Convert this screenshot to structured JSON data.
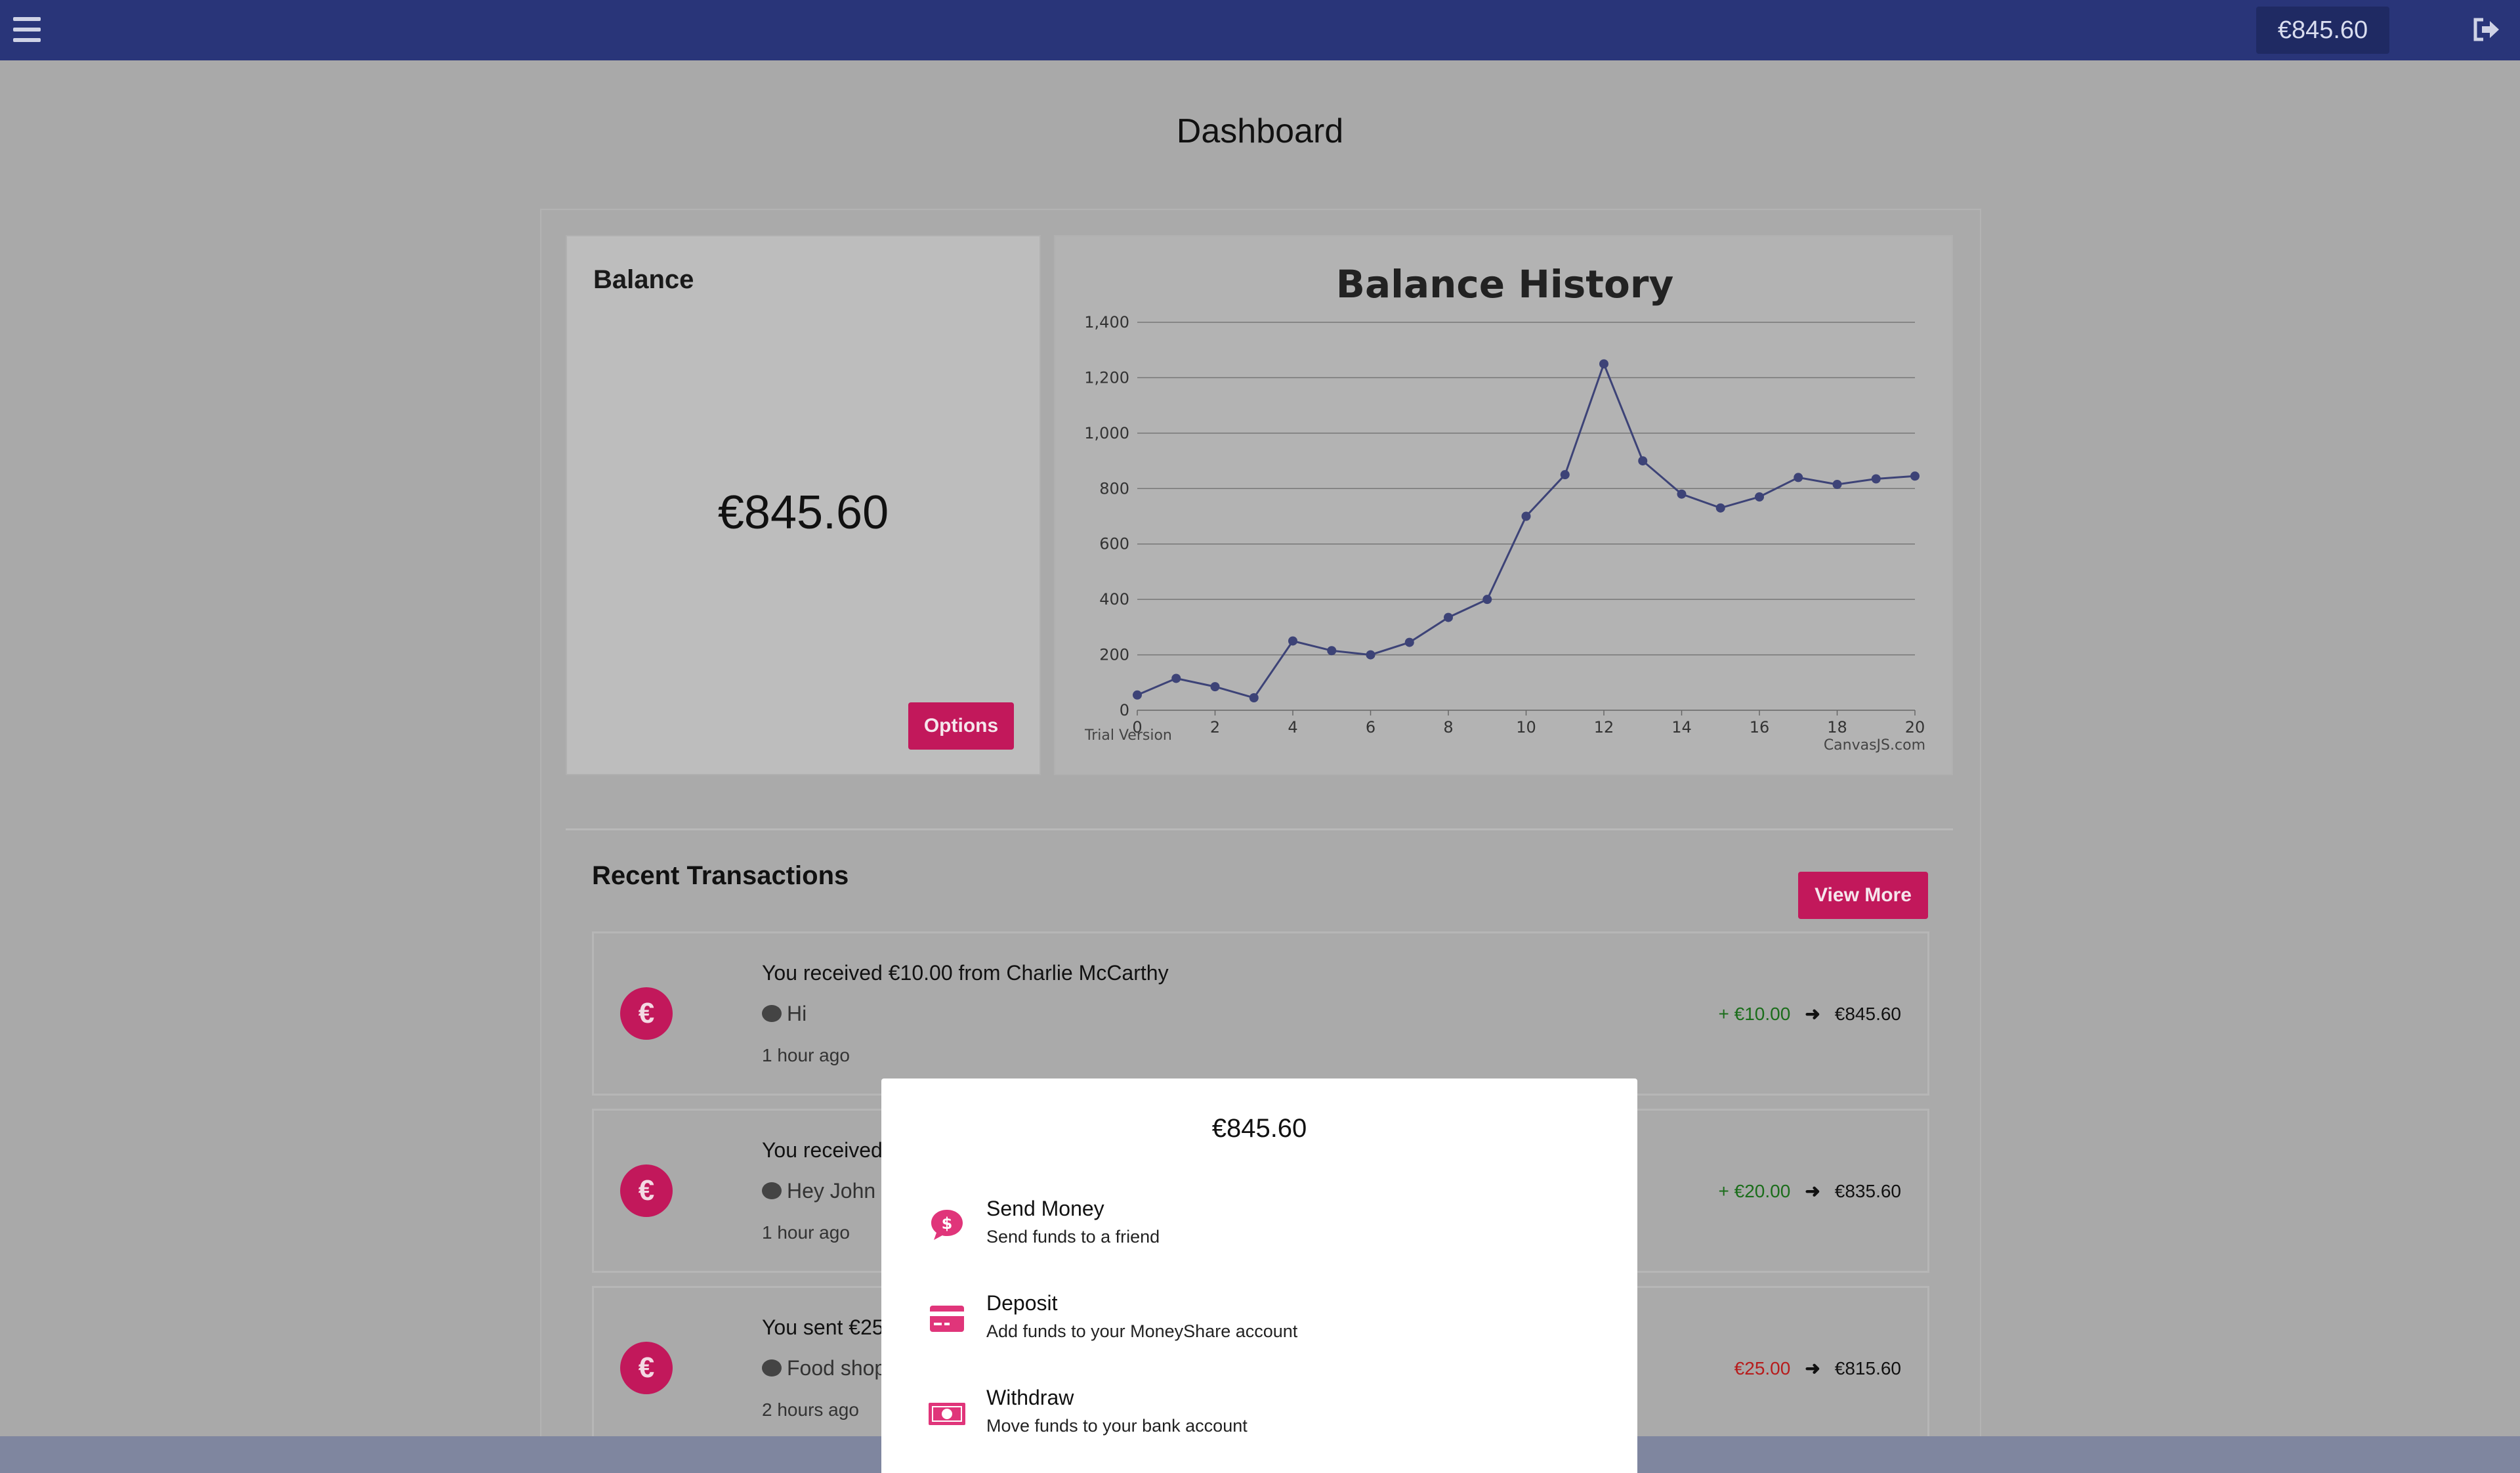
{
  "topbar": {
    "balance": "€845.60"
  },
  "page_title": "Dashboard",
  "balance_card": {
    "heading": "Balance",
    "amount": "€845.60",
    "options_label": "Options"
  },
  "chart": {
    "trial_text": "Trial Version",
    "credit": "CanvasJS.com"
  },
  "chart_data": {
    "type": "line",
    "title": "Balance History",
    "xlabel": "",
    "ylabel": "",
    "x": [
      0,
      1,
      2,
      3,
      4,
      5,
      6,
      7,
      8,
      9,
      10,
      11,
      12,
      13,
      14,
      15,
      16,
      17,
      18,
      19,
      20
    ],
    "series": [
      {
        "values": [
          55,
          115,
          85,
          45,
          250,
          215,
          200,
          245,
          335,
          400,
          700,
          850,
          1250,
          900,
          780,
          730,
          770,
          840,
          815,
          835,
          845
        ]
      }
    ],
    "xlim": [
      0,
      20
    ],
    "ylim": [
      0,
      1400
    ],
    "x_ticks": [
      "0",
      "2",
      "4",
      "6",
      "8",
      "10",
      "12",
      "14",
      "16",
      "18",
      "20"
    ],
    "y_ticks": [
      "0",
      "200",
      "400",
      "600",
      "800",
      "1,000",
      "1,200",
      "1,400"
    ],
    "grid": true,
    "line_color": "#3d4377"
  },
  "recent": {
    "heading": "Recent Transactions",
    "view_more_label": "View More",
    "items": [
      {
        "title": "You received €10.00 from Charlie McCarthy",
        "message": "Hi",
        "time": "1 hour ago",
        "change": "+ €10.00",
        "direction": "plus",
        "resulting": "€845.60"
      },
      {
        "title": "You received",
        "message": "Hey John",
        "time": "1 hour ago",
        "change": "+ €20.00",
        "direction": "plus",
        "resulting": "€835.60"
      },
      {
        "title": "You sent €25",
        "message": "Food shop",
        "time": "2 hours ago",
        "change": "€25.00",
        "direction": "minus",
        "resulting": "€815.60"
      }
    ]
  },
  "modal": {
    "amount": "€845.60",
    "actions": [
      {
        "title": "Send Money",
        "subtitle": "Send funds to a friend",
        "icon": "send-money-icon"
      },
      {
        "title": "Deposit",
        "subtitle": "Add funds to your MoneyShare account",
        "icon": "credit-card-icon"
      },
      {
        "title": "Withdraw",
        "subtitle": "Move funds to your bank account",
        "icon": "cash-icon"
      }
    ]
  },
  "colors": {
    "primary": "#c2185b",
    "topbar": "#293579",
    "plus": "#1b6d1b",
    "minus": "#b71c1c"
  }
}
